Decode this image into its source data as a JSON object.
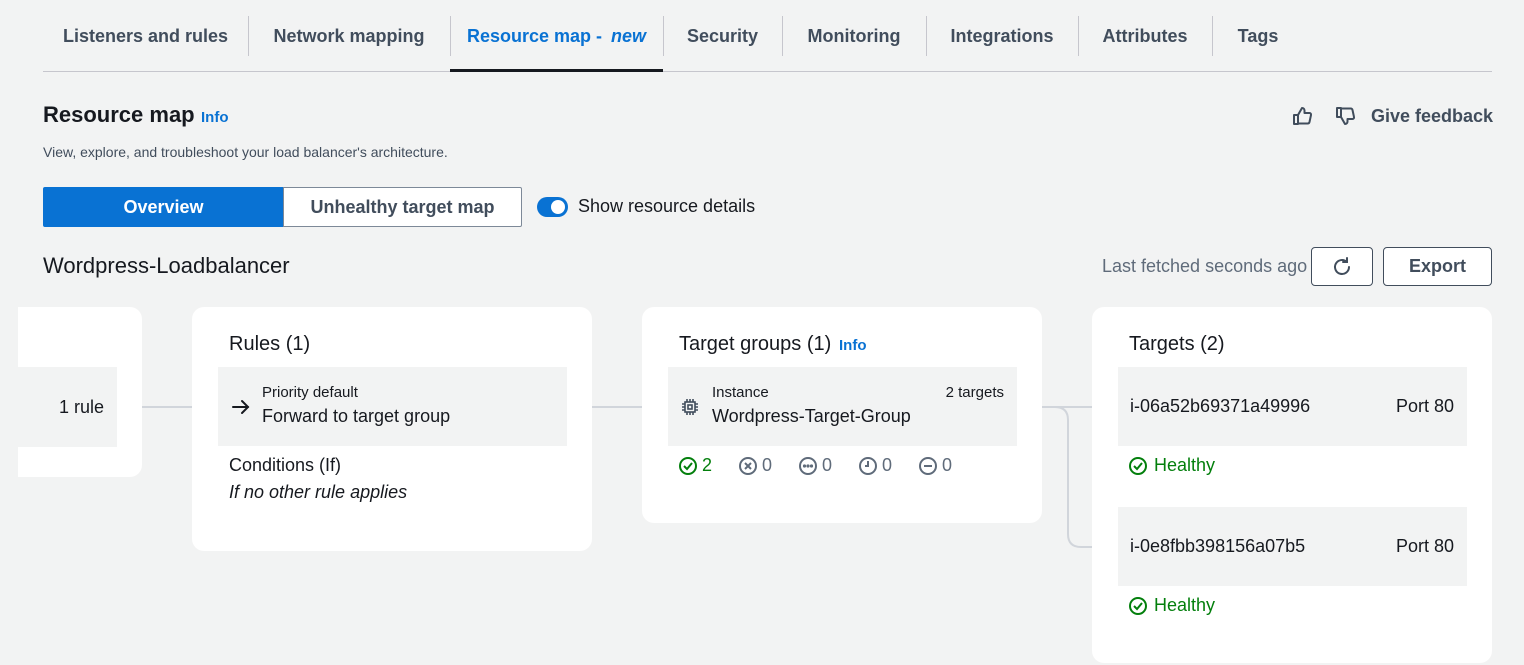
{
  "tabs": [
    {
      "label": "Listeners and rules"
    },
    {
      "label": "Network mapping"
    },
    {
      "label": "Resource map - ",
      "badge": "new"
    },
    {
      "label": "Security"
    },
    {
      "label": "Monitoring"
    },
    {
      "label": "Integrations"
    },
    {
      "label": "Attributes"
    },
    {
      "label": "Tags"
    }
  ],
  "header": {
    "title": "Resource map",
    "info": "Info",
    "description": "View, explore, and troubleshoot your load balancer's architecture.",
    "feedback_label": "Give feedback"
  },
  "view_toggle": {
    "overview": "Overview",
    "unhealthy": "Unhealthy target map",
    "show_details_label": "Show resource details",
    "show_details_on": true
  },
  "load_balancer": {
    "name": "Wordpress-Loadbalancer",
    "last_fetched": "Last fetched seconds ago",
    "export_label": "Export"
  },
  "listener": {
    "rule_count": "1 rule"
  },
  "rules": {
    "title": "Rules (1)",
    "priority": "Priority default",
    "action": "Forward to target group",
    "conditions_label": "Conditions (If)",
    "conditions_value": "If no other rule applies"
  },
  "target_groups": {
    "title": "Target groups (1)",
    "info": "Info",
    "type": "Instance",
    "count": "2 targets",
    "name": "Wordpress-Target-Group",
    "stats": {
      "healthy": "2",
      "unhealthy": "0",
      "unused": "0",
      "pending": "0",
      "draining": "0"
    }
  },
  "targets": {
    "title": "Targets (2)",
    "items": [
      {
        "id": "i-06a52b69371a49996",
        "port": "Port 80",
        "status": "Healthy"
      },
      {
        "id": "i-0e8fbb398156a07b5",
        "port": "Port 80",
        "status": "Healthy"
      }
    ]
  },
  "colors": {
    "accent": "#0972d3",
    "healthy": "#037f0c",
    "text_secondary": "#5f6b7a"
  }
}
